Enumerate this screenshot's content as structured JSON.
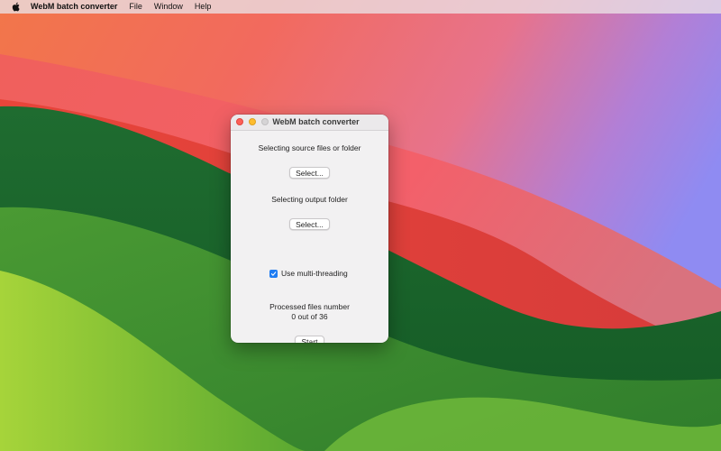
{
  "menubar": {
    "app_name": "WebM batch converter",
    "items": [
      "File",
      "Window",
      "Help"
    ]
  },
  "window": {
    "title": "WebM batch converter",
    "source_label": "Selecting source files or folder",
    "source_button": "Select...",
    "output_label": "Selecting output folder",
    "output_button": "Select...",
    "multithreading_label": "Use multi-threading",
    "multithreading_checked": true,
    "processed_label": "Processed files number",
    "processed_value": "0 out of 36",
    "start_button": "Start"
  },
  "colors": {
    "accent": "#1e7cf2",
    "close": "#fd5f57",
    "minimize": "#febc2e",
    "zoom_disabled": "#d6d4d6"
  },
  "icons": {
    "menubar_logo": "apple-logo-icon",
    "checkbox_mark": "checkmark-icon"
  }
}
